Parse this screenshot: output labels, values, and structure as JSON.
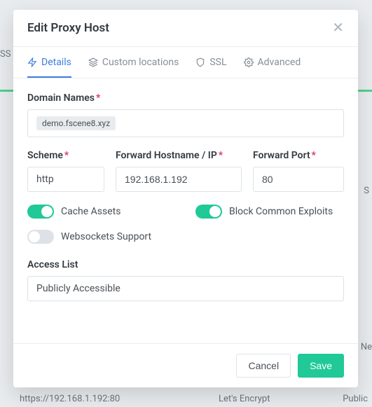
{
  "modal": {
    "title": "Edit Proxy Host",
    "tabs": {
      "details": "Details",
      "custom_locations": "Custom locations",
      "ssl": "SSL",
      "advanced": "Advanced"
    },
    "labels": {
      "domain_names": "Domain Names",
      "scheme": "Scheme",
      "forward_host": "Forward Hostname / IP",
      "forward_port": "Forward Port",
      "access_list": "Access List"
    },
    "values": {
      "domain_tag": "demo.fscene8.xyz",
      "scheme": "http",
      "forward_host": "192.168.1.192",
      "forward_port": "80",
      "access_list": "Publicly Accessible"
    },
    "toggles": {
      "cache_assets": {
        "label": "Cache Assets",
        "on": true
      },
      "block_exploits": {
        "label": "Block Common Exploits",
        "on": true
      },
      "websockets": {
        "label": "Websockets Support",
        "on": false
      }
    },
    "footer": {
      "cancel": "Cancel",
      "save": "Save"
    }
  },
  "background": {
    "left1": "SS",
    "right1": "S",
    "right2": "Ne",
    "bottom_left": "https://192.168.1.192:80",
    "bottom_mid": "Let's Encrypt",
    "bottom_right": "Public"
  }
}
